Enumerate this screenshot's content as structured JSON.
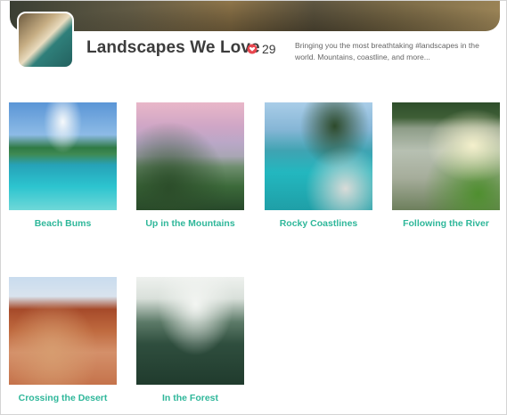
{
  "board": {
    "title": "Landscapes We Love",
    "like_count": "29",
    "description": "Bringing you the most breathtaking #landscapes in the world. Mountains, coastline, and more...",
    "icons": {
      "likes": "heart-icon"
    },
    "colors": {
      "accent": "#2fb79a",
      "heart": "#e8474f",
      "title": "#3c3c3c"
    }
  },
  "collections": [
    {
      "label": "Beach Bums"
    },
    {
      "label": "Up in the Mountains"
    },
    {
      "label": "Rocky Coastlines"
    },
    {
      "label": "Following the River"
    },
    {
      "label": "Crossing the Desert"
    },
    {
      "label": "In the Forest"
    }
  ]
}
